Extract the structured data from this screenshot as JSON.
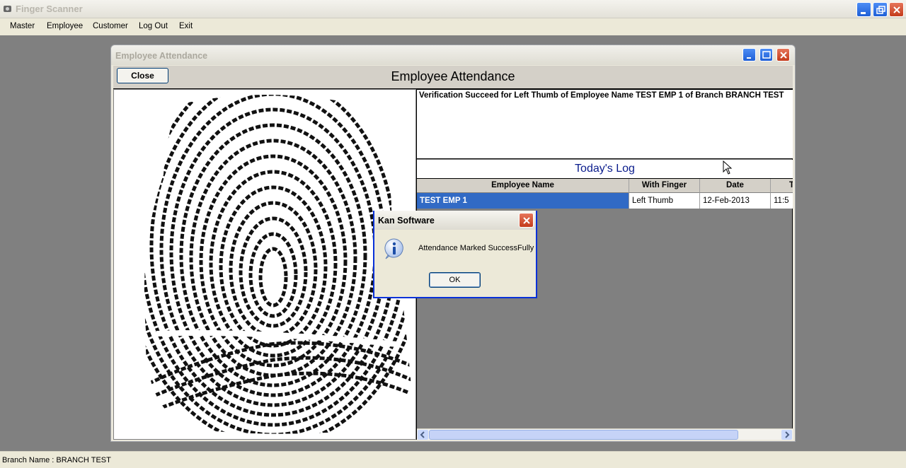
{
  "app": {
    "title": "Finger Scanner",
    "menu": [
      "Master",
      "Employee",
      "Customer",
      "Log Out",
      "Exit"
    ],
    "status": "Branch Name :  BRANCH TEST"
  },
  "window": {
    "title": "Employee Attendance",
    "close_label": "Close",
    "form_title": "Employee Attendance",
    "verification_text": "Verification Succeed for Left Thumb of Employee Name TEST EMP 1 of Branch BRANCH TEST",
    "log_title": "Today's Log",
    "columns": [
      "Employee Name",
      "With Finger",
      "Date",
      "T"
    ],
    "rows": [
      [
        "TEST EMP 1",
        "Left Thumb",
        "12-Feb-2013",
        "11:5"
      ]
    ]
  },
  "dialog": {
    "title": "Kan Software",
    "message": "Attendance Marked SuccessFully",
    "ok_label": "OK",
    "icon": "info-icon"
  },
  "colors": {
    "selection": "#316ac5",
    "xp_blue": "#0831d9",
    "log_title": "#0a1c8c"
  }
}
